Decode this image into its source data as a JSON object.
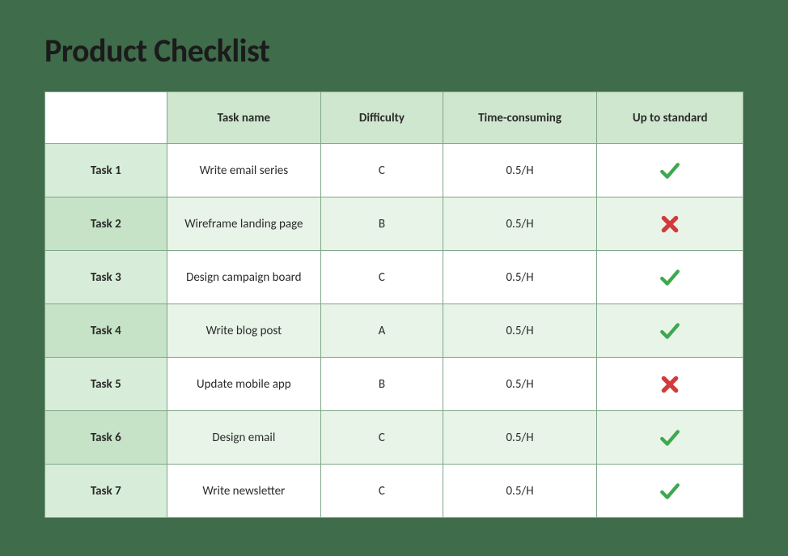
{
  "title": "Product Checklist",
  "columns": {
    "blank": "",
    "taskName": "Task name",
    "difficulty": "Difficulty",
    "time": "Time-consuming",
    "standard": "Up to standard"
  },
  "rows": [
    {
      "label": "Task 1",
      "name": "Write email series",
      "difficulty": "C",
      "time": "0.5/H",
      "standard": "check"
    },
    {
      "label": "Task 2",
      "name": "Wireframe landing page",
      "difficulty": "B",
      "time": "0.5/H",
      "standard": "cross"
    },
    {
      "label": "Task 3",
      "name": "Design campaign board",
      "difficulty": "C",
      "time": "0.5/H",
      "standard": "check"
    },
    {
      "label": "Task 4",
      "name": "Write blog post",
      "difficulty": "A",
      "time": "0.5/H",
      "standard": "check"
    },
    {
      "label": "Task 5",
      "name": "Update mobile app",
      "difficulty": "B",
      "time": "0.5/H",
      "standard": "cross"
    },
    {
      "label": "Task 6",
      "name": "Design email",
      "difficulty": "C",
      "time": "0.5/H",
      "standard": "check"
    },
    {
      "label": "Task 7",
      "name": "Write newsletter",
      "difficulty": "C",
      "time": "0.5/H",
      "standard": "check"
    }
  ]
}
